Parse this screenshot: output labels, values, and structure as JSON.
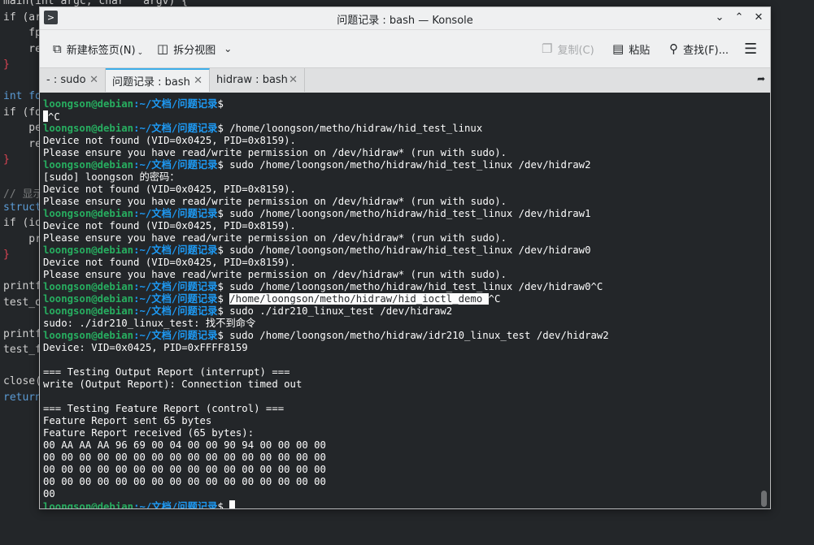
{
  "editor": {
    "lines": [
      {
        "text": "main(int argc, char   argv) {",
        "cls": ""
      },
      {
        "text": "if (ar",
        "cls": ""
      },
      {
        "text": "    fp",
        "cls": ""
      },
      {
        "text": "    re",
        "cls": ""
      },
      {
        "text": "}",
        "cls": "err"
      },
      {
        "text": "",
        "cls": ""
      },
      {
        "text": "int fd",
        "cls": "kw"
      },
      {
        "text": "if (fd",
        "cls": ""
      },
      {
        "text": "    pe",
        "cls": ""
      },
      {
        "text": "    re",
        "cls": ""
      },
      {
        "text": "}",
        "cls": "err"
      },
      {
        "text": "",
        "cls": ""
      },
      {
        "text": "// 显示",
        "cls": "comment"
      },
      {
        "text": "struct",
        "cls": "kw"
      },
      {
        "text": "if (io",
        "cls": ""
      },
      {
        "text": "    pr",
        "cls": ""
      },
      {
        "text": "}",
        "cls": "err"
      },
      {
        "text": "",
        "cls": ""
      },
      {
        "text": "printf",
        "cls": ""
      },
      {
        "text": "test_o",
        "cls": ""
      },
      {
        "text": "",
        "cls": ""
      },
      {
        "text": "printf",
        "cls": ""
      },
      {
        "text": "test_f",
        "cls": ""
      },
      {
        "text": "",
        "cls": ""
      },
      {
        "text": "close(",
        "cls": ""
      },
      {
        "text": "return",
        "cls": "kw"
      }
    ]
  },
  "window": {
    "title": "问题记录 : bash — Konsole"
  },
  "toolbar": {
    "new_tab": "新建标签页(N)",
    "split_view": "拆分视图",
    "copy": "复制(C)",
    "paste": "粘贴",
    "find": "查找(F)..."
  },
  "tabs": [
    {
      "label": "- : sudo"
    },
    {
      "label": "问题记录 : bash"
    },
    {
      "label": "hidraw : bash"
    }
  ],
  "prompt": {
    "user_host": "loongson@debian",
    "path": ":~/文档/问题记录",
    "symbol": "$ "
  },
  "terminal": {
    "lines": [
      {
        "type": "prompt",
        "cmd": ""
      },
      {
        "type": "cursorout",
        "text": "^C"
      },
      {
        "type": "prompt",
        "cmd": "/home/loongson/metho/hidraw/hid_test_linux"
      },
      {
        "type": "out",
        "text": "Device not found (VID=0x0425, PID=0x8159)."
      },
      {
        "type": "out",
        "text": "Please ensure you have read/write permission on /dev/hidraw* (run with sudo)."
      },
      {
        "type": "prompt",
        "cmd": "sudo /home/loongson/metho/hidraw/hid_test_linux /dev/hidraw2"
      },
      {
        "type": "out",
        "text": "[sudo] loongson 的密码："
      },
      {
        "type": "out",
        "text": "Device not found (VID=0x0425, PID=0x8159)."
      },
      {
        "type": "out",
        "text": "Please ensure you have read/write permission on /dev/hidraw* (run with sudo)."
      },
      {
        "type": "prompt",
        "cmd": "sudo /home/loongson/metho/hidraw/hid_test_linux /dev/hidraw1"
      },
      {
        "type": "out",
        "text": "Device not found (VID=0x0425, PID=0x8159)."
      },
      {
        "type": "out",
        "text": "Please ensure you have read/write permission on /dev/hidraw* (run with sudo)."
      },
      {
        "type": "prompt",
        "cmd": "sudo /home/loongson/metho/hidraw/hid_test_linux /dev/hidraw0"
      },
      {
        "type": "out",
        "text": "Device not found (VID=0x0425, PID=0x8159)."
      },
      {
        "type": "out",
        "text": "Please ensure you have read/write permission on /dev/hidraw* (run with sudo)."
      },
      {
        "type": "prompt",
        "cmd": "sudo /home/loongson/metho/hidraw/hid_test_linux /dev/hidraw0^C"
      },
      {
        "type": "prompt_hl",
        "hl": "/home/loongson/metho/hidraw/hid_ioctl_demo ",
        "cmd": "^C"
      },
      {
        "type": "prompt",
        "cmd": "sudo ./idr210_linux_test /dev/hidraw2"
      },
      {
        "type": "out",
        "text": "sudo: ./idr210_linux_test: 找不到命令"
      },
      {
        "type": "prompt",
        "cmd": "sudo /home/loongson/metho/hidraw/idr210_linux_test /dev/hidraw2"
      },
      {
        "type": "out",
        "text": "Device: VID=0x0425, PID=0xFFFF8159"
      },
      {
        "type": "out",
        "text": ""
      },
      {
        "type": "out",
        "text": "=== Testing Output Report (interrupt) ==="
      },
      {
        "type": "out",
        "text": "write (Output Report): Connection timed out"
      },
      {
        "type": "out",
        "text": ""
      },
      {
        "type": "out",
        "text": "=== Testing Feature Report (control) ==="
      },
      {
        "type": "out",
        "text": "Feature Report sent 65 bytes"
      },
      {
        "type": "out",
        "text": "Feature Report received (65 bytes):"
      },
      {
        "type": "out",
        "text": "00 AA AA AA 96 69 00 04 00 00 90 94 00 00 00 00"
      },
      {
        "type": "out",
        "text": "00 00 00 00 00 00 00 00 00 00 00 00 00 00 00 00"
      },
      {
        "type": "out",
        "text": "00 00 00 00 00 00 00 00 00 00 00 00 00 00 00 00"
      },
      {
        "type": "out",
        "text": "00 00 00 00 00 00 00 00 00 00 00 00 00 00 00 00"
      },
      {
        "type": "out",
        "text": "00"
      },
      {
        "type": "prompt_cursor",
        "cmd": ""
      }
    ]
  }
}
